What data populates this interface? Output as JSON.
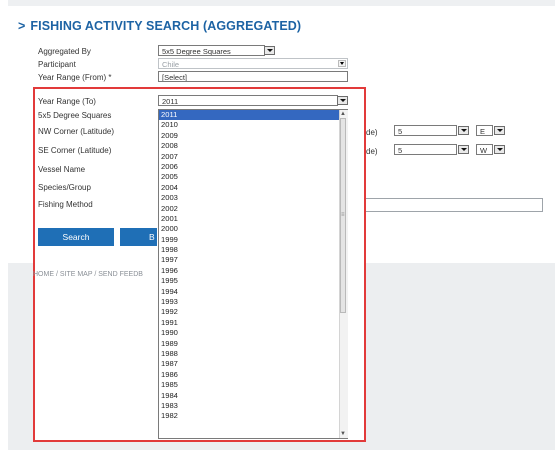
{
  "header": {
    "chevron": ">",
    "title": "FISHING ACTIVITY SEARCH (AGGREGATED)"
  },
  "form": {
    "aggregated_by": {
      "label": "Aggregated By",
      "value": "5x5 Degree Squares"
    },
    "participant": {
      "label": "Participant",
      "value": "Chile"
    },
    "year_from": {
      "label": "Year Range (From) *",
      "value": "[Select]"
    },
    "year_to": {
      "label": "Year Range (To)",
      "value": "2011"
    },
    "squares_label": "5x5 Degree Squares",
    "nw_corner": {
      "label": "NW Corner (Latitude)",
      "long_label": "de)",
      "value": "5",
      "dir": "E"
    },
    "se_corner": {
      "label": "SE Corner (Latitude)",
      "long_label": "de)",
      "value": "5",
      "dir": "W"
    },
    "vessel_name": {
      "label": "Vessel Name"
    },
    "species_group": {
      "label": "Species/Group"
    },
    "fishing_method": {
      "label": "Fishing Method"
    }
  },
  "buttons": {
    "search": "Search",
    "second_partial": "B"
  },
  "footer": {
    "links": "HOME / SITE MAP / SEND FEEDB"
  },
  "dropdown": {
    "options": [
      "2011",
      "2010",
      "2009",
      "2008",
      "2007",
      "2006",
      "2005",
      "2004",
      "2003",
      "2002",
      "2001",
      "2000",
      "1999",
      "1998",
      "1997",
      "1996",
      "1995",
      "1994",
      "1993",
      "1992",
      "1991",
      "1990",
      "1989",
      "1988",
      "1987",
      "1986",
      "1985",
      "1984",
      "1983",
      "1982"
    ],
    "selected": "2011"
  },
  "colors": {
    "title": "#1d63a4",
    "highlight_box": "#e23a3a",
    "selection": "#3468c0",
    "button": "#1f6fb6"
  }
}
